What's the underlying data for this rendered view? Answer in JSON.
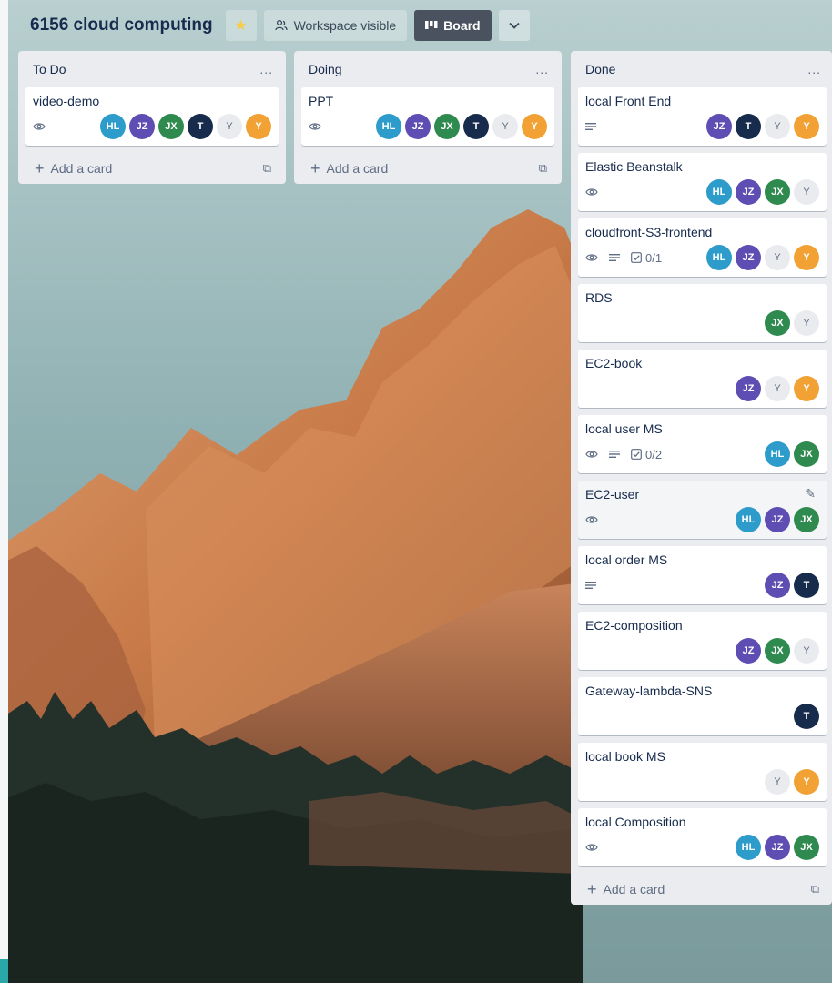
{
  "board": {
    "title": "6156 cloud computing",
    "visibility_label": "Workspace visible",
    "view_label": "Board"
  },
  "icons": {
    "star": "star-icon",
    "visibility": "people-icon",
    "board_view": "board-icon",
    "caret": "chevron-down-icon",
    "watch": "eye-icon",
    "description": "description-icon",
    "checklist": "checklist-icon",
    "edit": "pencil-icon",
    "add": "plus-icon",
    "template": "template-icon"
  },
  "colors": {
    "star": "#f5cd47",
    "HL": "#2e9cca",
    "JZ": "#5e4db2",
    "JX": "#2f8a4f",
    "T": "#172b4d",
    "Y_grey": "#e9ebee",
    "Y_orange": "#f2a134"
  },
  "lists": [
    {
      "title": "To Do",
      "menu": "...",
      "add_card": "Add a card",
      "cards": [
        {
          "title": "video-demo",
          "watch": true,
          "description": false,
          "checklist": "",
          "members": [
            "HL",
            "JZ",
            "JX",
            "T",
            "Y",
            "Y"
          ]
        }
      ]
    },
    {
      "title": "Doing",
      "menu": "...",
      "add_card": "Add a card",
      "cards": [
        {
          "title": "PPT",
          "watch": true,
          "description": false,
          "checklist": "",
          "members": [
            "HL",
            "JZ",
            "JX",
            "T",
            "Y",
            "Y"
          ]
        }
      ]
    },
    {
      "title": "Done",
      "menu": "...",
      "add_card": "Add a card",
      "cards": [
        {
          "title": "local Front End",
          "watch": false,
          "description": true,
          "checklist": "",
          "members": [
            "JZ",
            "T",
            "Y",
            "Y"
          ]
        },
        {
          "title": "Elastic Beanstalk",
          "watch": true,
          "description": false,
          "checklist": "",
          "members": [
            "HL",
            "JZ",
            "JX",
            "Y"
          ]
        },
        {
          "title": "cloudfront-S3-frontend",
          "watch": true,
          "description": true,
          "checklist": "0/1",
          "members": [
            "HL",
            "JZ",
            "Y",
            "Y"
          ]
        },
        {
          "title": "RDS",
          "watch": false,
          "description": false,
          "checklist": "",
          "members": [
            "JX",
            "Y"
          ]
        },
        {
          "title": "EC2-book",
          "watch": false,
          "description": false,
          "checklist": "",
          "members": [
            "JZ",
            "Y",
            "Y"
          ]
        },
        {
          "title": "local user MS",
          "watch": true,
          "description": true,
          "checklist": "0/2",
          "members": [
            "HL",
            "JX"
          ]
        },
        {
          "title": "EC2-user",
          "watch": true,
          "description": false,
          "checklist": "",
          "members": [
            "HL",
            "JZ",
            "JX"
          ],
          "editing": true
        },
        {
          "title": "local order MS",
          "watch": false,
          "description": true,
          "checklist": "",
          "members": [
            "JZ",
            "T"
          ]
        },
        {
          "title": "EC2-composition",
          "watch": false,
          "description": false,
          "checklist": "",
          "members": [
            "JZ",
            "JX",
            "Y"
          ]
        },
        {
          "title": "Gateway-lambda-SNS",
          "watch": false,
          "description": false,
          "checklist": "",
          "members": [
            "T"
          ]
        },
        {
          "title": "local book MS",
          "watch": false,
          "description": false,
          "checklist": "",
          "members": [
            "Y",
            "Y"
          ]
        },
        {
          "title": "local Composition",
          "watch": true,
          "description": false,
          "checklist": "",
          "members": [
            "HL",
            "JZ",
            "JX"
          ]
        }
      ]
    }
  ]
}
